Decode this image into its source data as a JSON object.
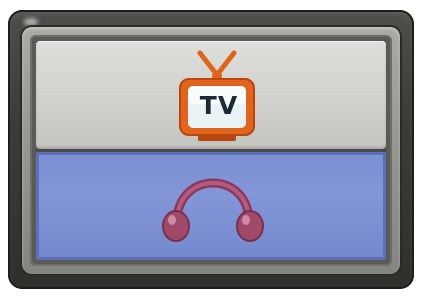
{
  "panel": {
    "buttons": [
      {
        "id": "tv",
        "label": "TV",
        "icon": "tv-icon",
        "background": "#cfd0cc"
      },
      {
        "id": "audio",
        "label": "",
        "icon": "headphones-icon",
        "background": "#8296d8"
      }
    ]
  },
  "colors": {
    "device_frame": "#3b3c38",
    "bezel": "#959690",
    "tv_frame": "#e0641c",
    "tv_screen": "#e9f3f6",
    "tv_text": "#1d2a33",
    "headphones": "#a04a6a",
    "audio_panel": "#8296d8"
  }
}
